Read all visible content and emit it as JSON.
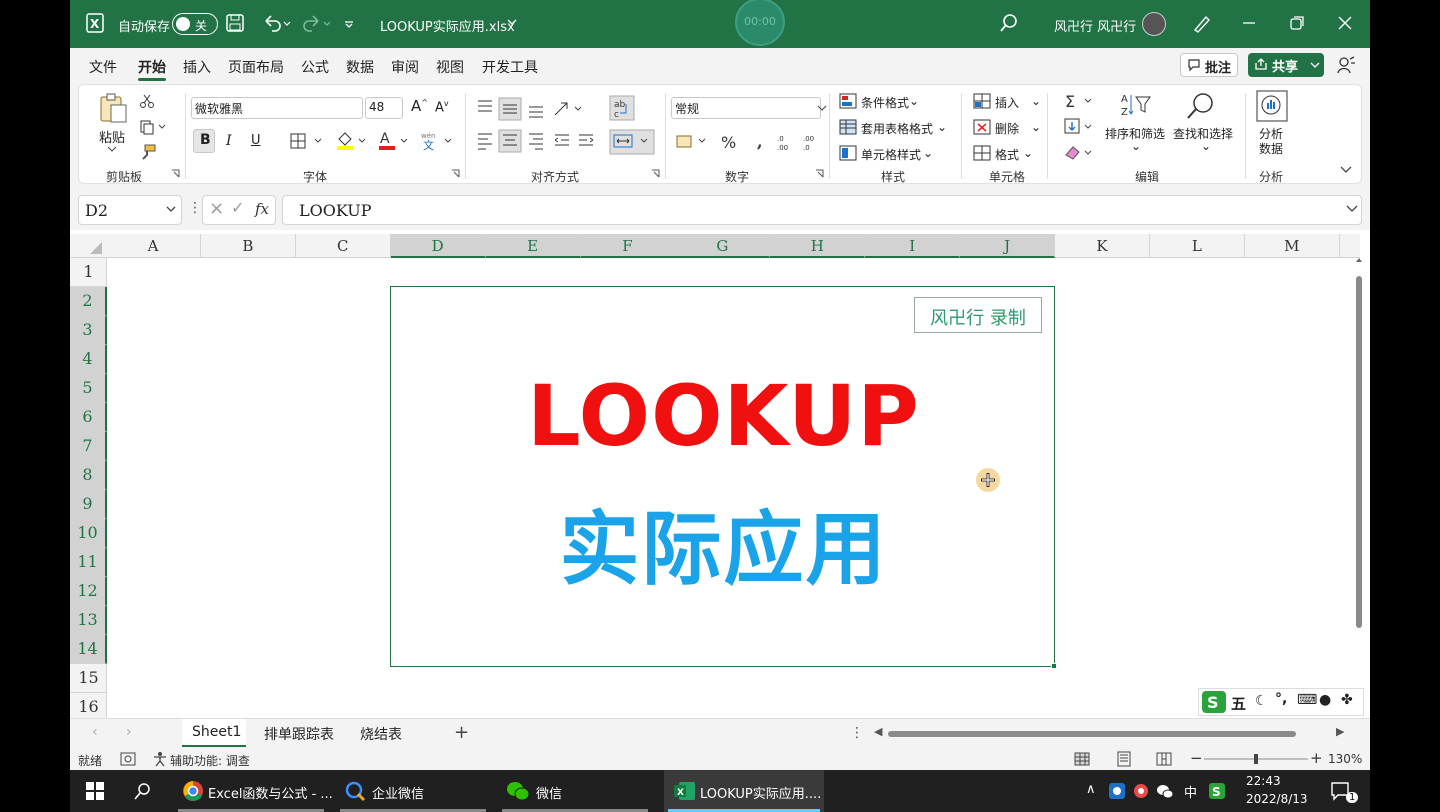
{
  "titlebar": {
    "autosave_label": "自动保存",
    "autosave_state": "关",
    "filename": "LOOKUP实际应用.xlsx",
    "recorder_time": "00:00",
    "user_name": "风卍行 风卍行"
  },
  "menu": {
    "items": [
      "文件",
      "开始",
      "插入",
      "页面布局",
      "公式",
      "数据",
      "审阅",
      "视图",
      "开发工具"
    ],
    "active": "开始",
    "comment_label": "批注",
    "share_label": "共享"
  },
  "ribbon": {
    "clipboard": {
      "paste": "粘贴",
      "group": "剪贴板"
    },
    "font": {
      "name": "微软雅黑",
      "size": "48",
      "bold": "B",
      "italic": "I",
      "underline": "U",
      "group": "字体"
    },
    "alignment": {
      "group": "对齐方式"
    },
    "number": {
      "format": "常规",
      "group": "数字"
    },
    "styles": {
      "conditional": "条件格式",
      "table": "套用表格格式",
      "cell": "单元格样式",
      "group": "样式"
    },
    "cells": {
      "insert": "插入",
      "delete": "删除",
      "format": "格式",
      "group": "单元格"
    },
    "editing": {
      "sort": "排序和筛选",
      "find": "查找和选择",
      "group": "编辑"
    },
    "analysis": {
      "analyze_l1": "分析",
      "analyze_l2": "数据",
      "group": "分析"
    }
  },
  "formula_bar": {
    "name_box": "D2",
    "formula": "LOOKUP",
    "fx": "fx"
  },
  "grid": {
    "columns": [
      "A",
      "B",
      "C",
      "D",
      "E",
      "F",
      "G",
      "H",
      "I",
      "J",
      "K",
      "L",
      "M"
    ],
    "selected_columns": [
      "D",
      "E",
      "F",
      "G",
      "H",
      "I",
      "J"
    ],
    "rows": [
      "1",
      "2",
      "3",
      "4",
      "5",
      "6",
      "7",
      "8",
      "9",
      "10",
      "11",
      "12",
      "13",
      "14",
      "15",
      "16"
    ],
    "selected_rows": [
      "2",
      "3",
      "4",
      "5",
      "6",
      "7",
      "8",
      "9",
      "10",
      "11",
      "12",
      "13",
      "14"
    ],
    "watermark": "风卍行 录制",
    "title": "LOOKUP",
    "subtitle": "实际应用"
  },
  "ime": {
    "label": "五"
  },
  "sheets": {
    "tabs": [
      "Sheet1",
      "排单跟踪表",
      "烧结表"
    ],
    "active": "Sheet1"
  },
  "status": {
    "ready": "就绪",
    "accessibility": "辅助功能: 调查",
    "zoom": "130%"
  },
  "taskbar": {
    "chrome": "Excel函数与公式 - ...",
    "wecom": "企业微信",
    "wechat": "微信",
    "excel": "LOOKUP实际应用....",
    "ime_lang": "中",
    "time": "22:43",
    "date": "2022/8/13",
    "notifications": "1"
  },
  "colors": {
    "excel_green": "#217346",
    "title_red": "#f01010",
    "subtitle_blue": "#1aa3e8"
  }
}
